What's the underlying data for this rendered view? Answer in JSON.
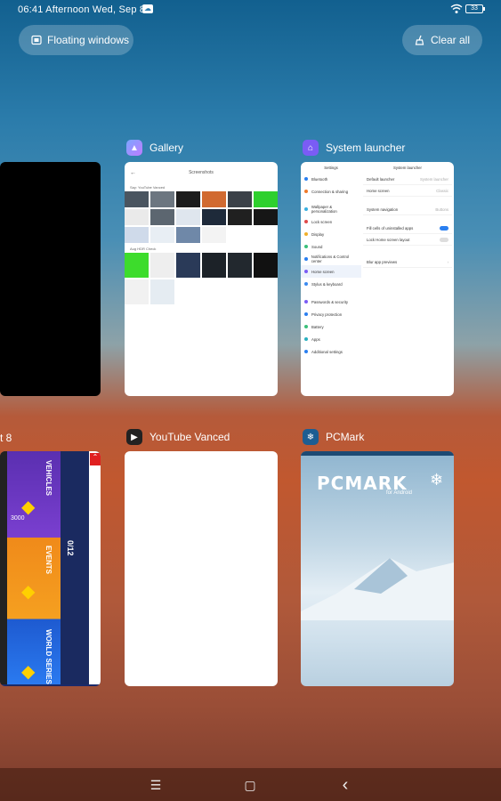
{
  "status_bar": {
    "time_text": "06:41 Afternoon  Wed, Sep 8",
    "battery": "33"
  },
  "actions": {
    "floating_windows": "Floating windows",
    "clear_all": "Clear all"
  },
  "apps": [
    {
      "name": "Gallery"
    },
    {
      "name": "System launcher"
    },
    {
      "name": "t 8"
    },
    {
      "name": "YouTube Vanced"
    },
    {
      "name": "PCMark"
    }
  ],
  "gallery_preview": {
    "title": "Screenshots",
    "section1": "Say: YouTube Vanced",
    "section2": "Aug  HDR Check"
  },
  "launcher_preview": {
    "left_header": "Settings",
    "right_header": "System launcher",
    "left_items": [
      "Bluetooth",
      "Connection & sharing",
      "Wallpaper & personalization",
      "Lock screen",
      "Display",
      "Sound",
      "Notifications & Control center",
      "Home screen",
      "Stylus & keyboard",
      "Passwords & security",
      "Privacy protection",
      "Battery",
      "Apps",
      "Additional settings"
    ],
    "right_rows": [
      "Default launcher",
      "Home screen",
      "System navigation",
      "Fill cells of uninstalled apps",
      "Lock Home screen layout",
      "Blur app previews"
    ],
    "right_values": [
      "System launcher",
      "Classic",
      "Buttons"
    ]
  },
  "game_preview": {
    "text1": "VEHICLES",
    "text2": "EVENTS",
    "text3": "WORLD SERIES",
    "counter": "0/12",
    "score": "3000"
  },
  "pcmark_preview": {
    "logo": "PCMARK",
    "sub": "for Android"
  },
  "nav": {
    "menu": "☰",
    "home": "▢",
    "back": "‹"
  }
}
